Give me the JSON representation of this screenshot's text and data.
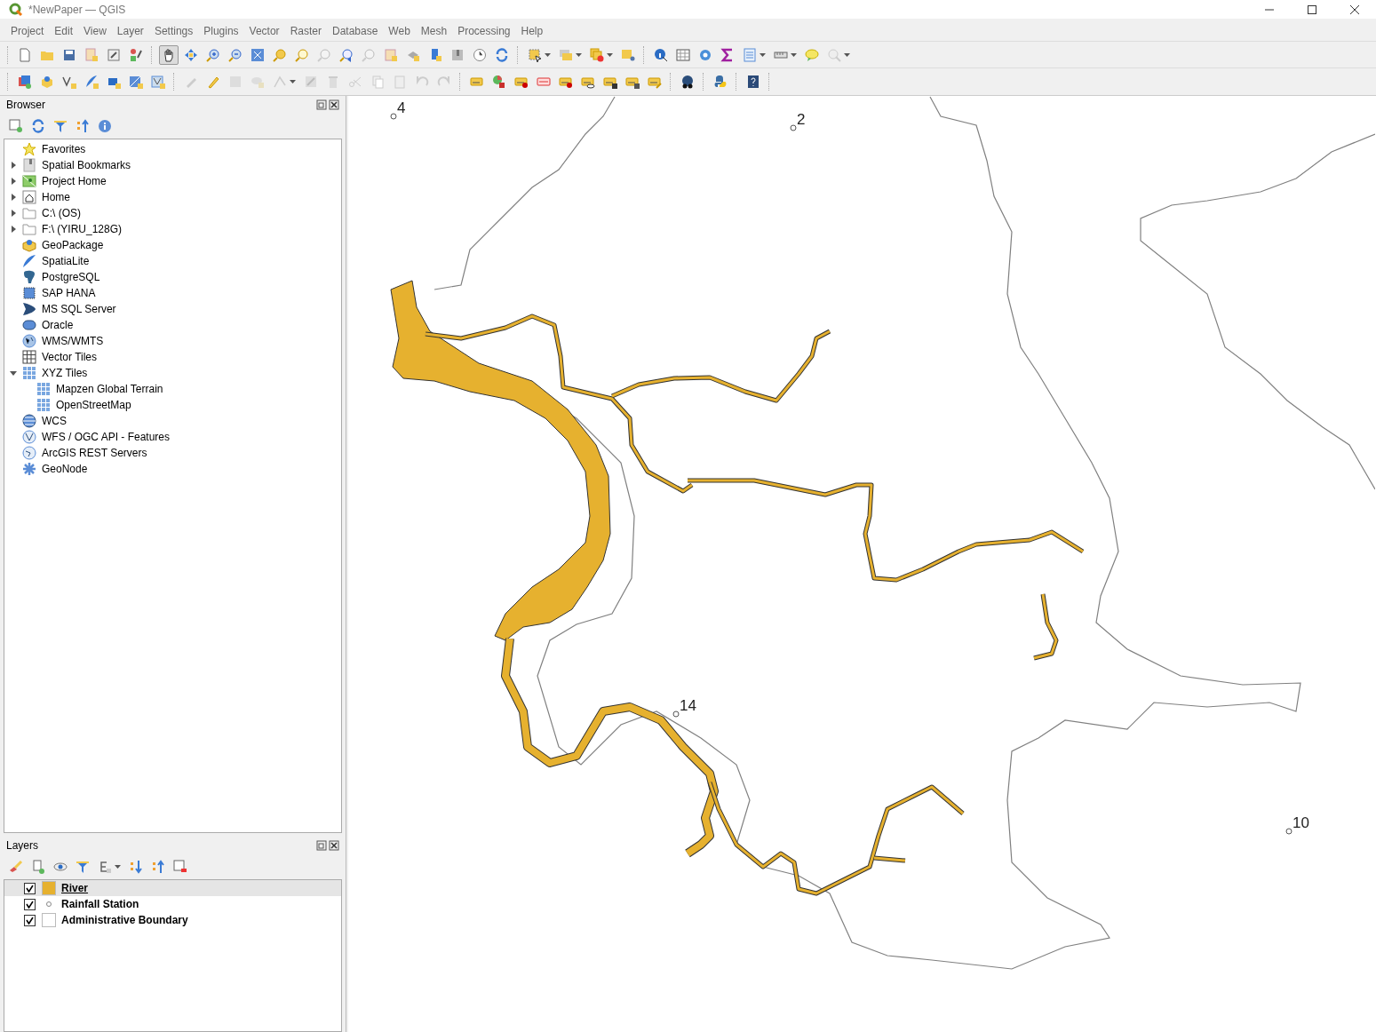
{
  "window": {
    "title": "*NewPaper — QGIS"
  },
  "menu": [
    "Project",
    "Edit",
    "View",
    "Layer",
    "Settings",
    "Plugins",
    "Vector",
    "Raster",
    "Database",
    "Web",
    "Mesh",
    "Processing",
    "Help"
  ],
  "map_tools": [
    {
      "kind": "pan",
      "selected": true
    },
    {
      "kind": "pan-selection",
      "selected": false
    },
    {
      "kind": "zoom-in",
      "selected": false
    },
    {
      "kind": "zoom-out",
      "selected": false
    },
    {
      "kind": "zoom-full",
      "selected": false
    },
    {
      "kind": "zoom-layer",
      "selected": false
    },
    {
      "kind": "zoom-selection",
      "selected": false
    },
    {
      "kind": "zoom-native",
      "selected": false
    },
    {
      "kind": "zoom-last",
      "selected": false
    },
    {
      "kind": "zoom-next",
      "selected": false
    }
  ],
  "browser": {
    "title": "Browser",
    "items": [
      {
        "label": "Favorites"
      },
      {
        "label": "Spatial Bookmarks",
        "expanded": false
      },
      {
        "label": "Project Home",
        "expanded": false
      },
      {
        "label": "Home",
        "expanded": false
      },
      {
        "label": "C:\\ (OS)",
        "expanded": false
      },
      {
        "label": "F:\\ (YIRU_128G)",
        "expanded": false
      },
      {
        "label": "GeoPackage"
      },
      {
        "label": "SpatiaLite"
      },
      {
        "label": "PostgreSQL"
      },
      {
        "label": "SAP HANA"
      },
      {
        "label": "MS SQL Server"
      },
      {
        "label": "Oracle"
      },
      {
        "label": "WMS/WMTS"
      },
      {
        "label": "Vector Tiles"
      },
      {
        "label": "XYZ Tiles",
        "expanded": true,
        "children": [
          {
            "label": "Mapzen Global Terrain"
          },
          {
            "label": "OpenStreetMap"
          }
        ]
      },
      {
        "label": "WCS"
      },
      {
        "label": "WFS / OGC API - Features"
      },
      {
        "label": "ArcGIS REST Servers"
      },
      {
        "label": "GeoNode"
      }
    ]
  },
  "layers": {
    "title": "Layers",
    "items": [
      {
        "name": "River",
        "checked": true,
        "selected": true,
        "kind": "fill",
        "color": "#e6b12f"
      },
      {
        "name": "Rainfall Station",
        "checked": true,
        "selected": false,
        "kind": "point"
      },
      {
        "name": "Administrative Boundary",
        "checked": true,
        "selected": false,
        "kind": "fill",
        "color": "#ffffff"
      }
    ]
  },
  "map": {
    "station_labels": [
      "4",
      "2",
      "14",
      "10"
    ]
  }
}
